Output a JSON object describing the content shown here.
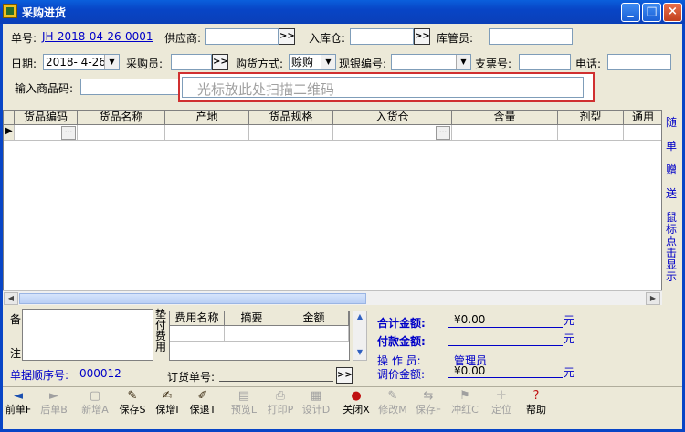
{
  "window": {
    "title": "采购进货"
  },
  "form": {
    "order_no_label": "单号:",
    "order_no_value": "JH-2018-04-26-0001",
    "supplier_label": "供应商:",
    "warehouse_label": "入库仓:",
    "keeper_label": "库管员:",
    "date_label": "日期:",
    "date_value": "2018- 4-26",
    "buyer_label": "采购员:",
    "method_label": "购货方式:",
    "method_value": "赊购",
    "cash_label": "现银编号:",
    "check_label": "支票号:",
    "phone_label": "电话:",
    "input_code_label": "输入商品码:",
    "scan_placeholder": "光标放此处扫描二维码",
    "browse_symbol": ">>"
  },
  "grid": {
    "columns": [
      "货品编码",
      "货品名称",
      "产地",
      "货品规格",
      "入货仓",
      "含量",
      "剂型",
      "通用"
    ],
    "row_ellipsis": "..."
  },
  "sidebar": {
    "chars": [
      "随",
      "单",
      "赠",
      "送",
      "鼠",
      "标",
      "点",
      "击",
      "显",
      "示"
    ]
  },
  "bottom": {
    "memo_label_top": "备",
    "memo_label_bottom": "注",
    "serial_label": "单据顺序号:",
    "serial_value": "000012",
    "advance_label": [
      "垫",
      "付",
      "费",
      "用"
    ],
    "fee_columns": [
      "费用名称",
      "摘要",
      "金额"
    ],
    "order_ref_label": "订货单号:",
    "total_label": "合计金额:",
    "total_value": "¥0.00",
    "paid_label": "付款金额:",
    "currency_unit": "元",
    "operator_label": "操 作 员:",
    "operator_value": "管理员",
    "adjust_label": "调价金额:",
    "adjust_value": "¥0.00"
  },
  "toolbar": [
    {
      "label": "前单F",
      "enabled": true,
      "icon": "arrow-left-icon"
    },
    {
      "label": "后单B",
      "enabled": false,
      "icon": "arrow-right-icon"
    },
    {
      "label": "新增A",
      "enabled": false,
      "icon": "new-icon"
    },
    {
      "label": "保存S",
      "enabled": true,
      "icon": "pen-icon"
    },
    {
      "label": "保增I",
      "enabled": true,
      "icon": "pen-add-icon"
    },
    {
      "label": "保退T",
      "enabled": true,
      "icon": "pen-back-icon"
    },
    {
      "label": "预览L",
      "enabled": false,
      "icon": "preview-icon"
    },
    {
      "label": "打印P",
      "enabled": false,
      "icon": "print-icon"
    },
    {
      "label": "设计D",
      "enabled": false,
      "icon": "design-icon"
    },
    {
      "label": "关闭X",
      "enabled": true,
      "icon": "close-icon"
    },
    {
      "label": "修改M",
      "enabled": false,
      "icon": "edit-icon"
    },
    {
      "label": "保存F",
      "enabled": false,
      "icon": "save-icon"
    },
    {
      "label": "冲红C",
      "enabled": false,
      "icon": "reverse-icon"
    },
    {
      "label": "定位",
      "enabled": false,
      "icon": "locate-icon"
    },
    {
      "label": "帮助",
      "enabled": true,
      "icon": "help-icon"
    }
  ]
}
